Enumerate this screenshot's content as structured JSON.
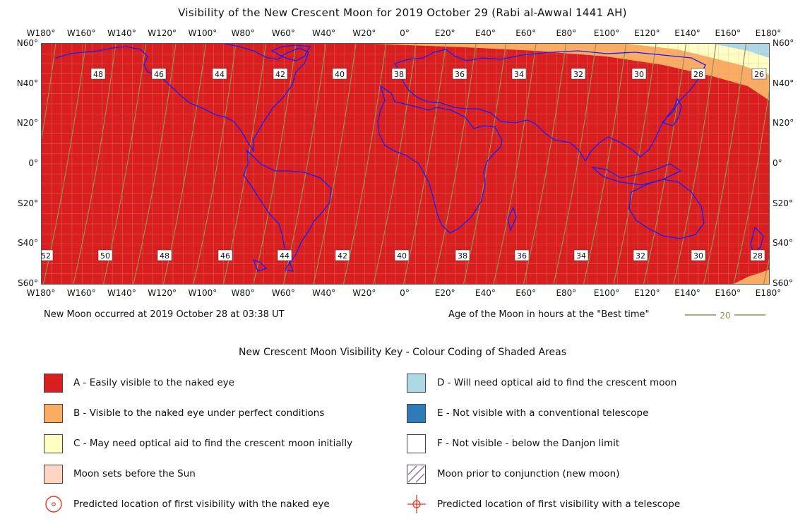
{
  "title": "Visibility of the New Crescent Moon for 2019 October 29 (Rabi al-Awwal 1441 AH)",
  "longitude_labels": [
    "W180°",
    "W160°",
    "W140°",
    "W120°",
    "W100°",
    "W80°",
    "W60°",
    "W40°",
    "W20°",
    "0°",
    "E20°",
    "E40°",
    "E60°",
    "E80°",
    "E100°",
    "E120°",
    "E140°",
    "E160°",
    "E180°"
  ],
  "latitude_labels": [
    "N60°",
    "N40°",
    "N20°",
    "0°",
    "S20°",
    "S40°",
    "S60°"
  ],
  "top_age_labels": [
    "48",
    "46",
    "44",
    "42",
    "40",
    "38",
    "36",
    "34",
    "32",
    "30",
    "28",
    "26"
  ],
  "bottom_age_labels": [
    "52",
    "50",
    "48",
    "46",
    "44",
    "42",
    "40",
    "38",
    "36",
    "34",
    "32",
    "30",
    "28"
  ],
  "new_moon_text": "New Moon occurred at 2019 October 28 at 03:38 UT",
  "age_legend_text": "Age of the Moon in hours at the \"Best time\"",
  "age_legend_sample": "20",
  "key": {
    "title": "New Crescent Moon Visibility Key - Colour Coding of Shaded Areas",
    "items": [
      {
        "label": "A - Easily visible to the naked eye",
        "color": "#d81e1e"
      },
      {
        "label": "B - Visible to the naked eye under perfect conditions",
        "color": "#fbac63"
      },
      {
        "label": "C - May need optical aid to find the crescent moon initially",
        "color": "#ffffc4"
      },
      {
        "label": "Moon sets before the Sun",
        "color": "#fdd4c2"
      },
      {
        "label": "Predicted location of first visibility with the naked eye",
        "color": "#ee3322"
      },
      {
        "label": "D - Will need optical aid to find the crescent moon",
        "color": "#add8e6"
      },
      {
        "label": "E - Not visible with a conventional telescope",
        "color": "#2f7ab8"
      },
      {
        "label": "F - Not visible - below the Danjon limit",
        "color": "#ffffff"
      },
      {
        "label": "Moon prior to conjunction (new moon)",
        "color": "#8b6a9a"
      },
      {
        "label": "Predicted location of first visibility with a telescope",
        "color": "#ee3322"
      }
    ]
  },
  "colors": {
    "zone_A": "#d81e1e",
    "zone_B": "#fbac63",
    "zone_C": "#ffffc4",
    "zone_D": "#add8e6",
    "coastline": "#1a1aff",
    "borders": "#cc8a4a",
    "age_contours": "#9a8e55",
    "grid": "#e59a9a"
  }
}
